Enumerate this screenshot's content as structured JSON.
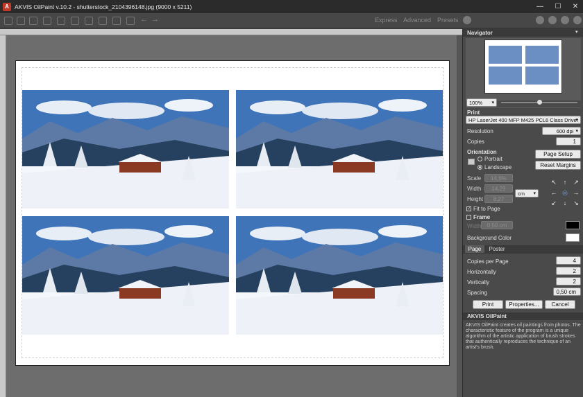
{
  "window": {
    "title": "AKVIS OilPaint v.10.2 - shutterstock_2104396148.jpg (9000 x 5211)",
    "minimize": "—",
    "maximize": "☐",
    "close": "✕"
  },
  "toolbar": {
    "modes": [
      "Express",
      "Advanced",
      "Presets"
    ]
  },
  "navigator": {
    "header": "Navigator",
    "zoom": "100%"
  },
  "print": {
    "header": "Print",
    "printer": "HP LaserJet 400 MFP M425 PCL6 Class Driver",
    "resolution_label": "Resolution",
    "resolution": "600 dpi",
    "copies_label": "Copies",
    "copies": "1",
    "orientation_label": "Orientation",
    "portrait": "Portrait",
    "landscape": "Landscape",
    "page_setup": "Page Setup",
    "reset_margins": "Reset Margins",
    "scale_label": "Scale",
    "scale": "14,6%",
    "width_label": "Width",
    "width": "14,29",
    "height_label": "Height",
    "height": "8,27",
    "unit": "cm",
    "fit_to_page": "Fit to Page",
    "frame_label": "Frame",
    "frame_width_label": "Width",
    "frame_width": "0,50 cm",
    "background_label": "Background Color",
    "frame_color": "#000000",
    "background_color": "#ffffff"
  },
  "tabs": {
    "page": "Page",
    "poster": "Poster"
  },
  "page_tab": {
    "copies_per_page_label": "Copies per Page",
    "copies_per_page": "4",
    "horizontally_label": "Horizontally",
    "horizontally": "2",
    "vertically_label": "Vertically",
    "vertically": "2",
    "spacing_label": "Spacing",
    "spacing": "0,50 cm"
  },
  "actions": {
    "print": "Print",
    "properties": "Properties...",
    "cancel": "Cancel"
  },
  "about": {
    "header": "AKVIS OilPaint",
    "text": "AKVIS OilPaint creates oil paintings from photos. The characteristic feature of the program is a unique algorithm of the artistic application of brush strokes that authentically reproduces the technique of an artist's brush."
  }
}
